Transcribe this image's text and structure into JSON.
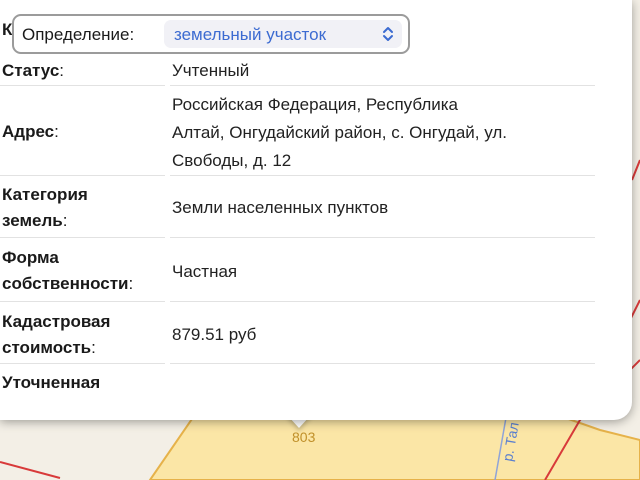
{
  "header": {
    "partial_label": "К",
    "label": "Определение:",
    "selected": "земельный участок"
  },
  "rows": [
    {
      "label": "Статус",
      "colon": ":",
      "value_lines": [
        "Учтенный"
      ]
    },
    {
      "label": "Адрес",
      "colon": ":",
      "value_lines": [
        "Российская Федерация, Республика",
        "Алтай, Онгудайский район, с. Онгудай, ул.",
        "Свободы, д. 12"
      ]
    },
    {
      "label_lines": [
        "Категория",
        "земель"
      ],
      "colon": ":",
      "value_lines": [
        "Земли населенных пунктов"
      ]
    },
    {
      "label_lines": [
        "Форма",
        "собственности"
      ],
      "colon": ":",
      "value_lines": [
        "Частная"
      ]
    },
    {
      "label_lines": [
        "Кадастровая",
        "стоимость"
      ],
      "colon": ":",
      "value_lines": [
        "879.51 руб"
      ]
    },
    {
      "label_lines": [
        "Уточненная"
      ],
      "colon": "",
      "value_lines": []
    }
  ],
  "map": {
    "parcel_number": "803",
    "street_label": "р. Тал",
    "colors": {
      "parcel_fill": "#fbe6a6",
      "border_red": "#d83a3a",
      "street": "#5a7fcf"
    }
  }
}
